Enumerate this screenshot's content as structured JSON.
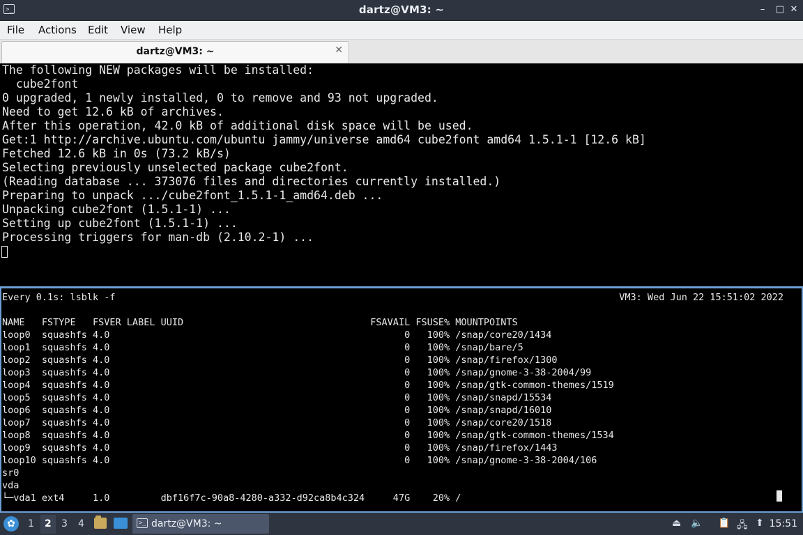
{
  "window": {
    "title": "dartz@VM3: ~",
    "app_icon": ">_",
    "minimize": "–",
    "maximize": "□",
    "close": "✕"
  },
  "menu": {
    "file": "File",
    "actions": "Actions",
    "edit": "Edit",
    "view": "View",
    "help": "Help"
  },
  "tab": {
    "label": "dartz@VM3: ~",
    "close": "✕"
  },
  "term_top": {
    "lines": [
      "The following NEW packages will be installed:",
      "  cube2font",
      "0 upgraded, 1 newly installed, 0 to remove and 93 not upgraded.",
      "Need to get 12.6 kB of archives.",
      "After this operation, 42.0 kB of additional disk space will be used.",
      "Get:1 http://archive.ubuntu.com/ubuntu jammy/universe amd64 cube2font amd64 1.5.1-1 [12.6 kB]",
      "Fetched 12.6 kB in 0s (73.2 kB/s)",
      "Selecting previously unselected package cube2font.",
      "(Reading database ... 373076 files and directories currently installed.)",
      "Preparing to unpack .../cube2font_1.5.1-1_amd64.deb ...",
      "Unpacking cube2font (1.5.1-1) ...",
      "Setting up cube2font (1.5.1-1) ...",
      "Processing triggers for man-db (2.10.2-1) ..."
    ]
  },
  "term_bottom": {
    "header_left": "Every 0.1s: lsblk -f",
    "header_right": "VM3: Wed Jun 22 15:51:02 2022",
    "lines": [
      "NAME   FSTYPE   FSVER LABEL UUID                                 FSAVAIL FSUSE% MOUNTPOINTS",
      "loop0  squashfs 4.0                                                    0   100% /snap/core20/1434",
      "loop1  squashfs 4.0                                                    0   100% /snap/bare/5",
      "loop2  squashfs 4.0                                                    0   100% /snap/firefox/1300",
      "loop3  squashfs 4.0                                                    0   100% /snap/gnome-3-38-2004/99",
      "loop4  squashfs 4.0                                                    0   100% /snap/gtk-common-themes/1519",
      "loop5  squashfs 4.0                                                    0   100% /snap/snapd/15534",
      "loop6  squashfs 4.0                                                    0   100% /snap/snapd/16010",
      "loop7  squashfs 4.0                                                    0   100% /snap/core20/1518",
      "loop8  squashfs 4.0                                                    0   100% /snap/gtk-common-themes/1534",
      "loop9  squashfs 4.0                                                    0   100% /snap/firefox/1443",
      "loop10 squashfs 4.0                                                    0   100% /snap/gnome-3-38-2004/106",
      "sr0",
      "vda",
      "└─vda1 ext4     1.0         dbf16f7c-90a8-4280-a332-d92ca8b4c324     47G    20% /"
    ]
  },
  "taskbar": {
    "start_icon": "✿",
    "workspaces": [
      "1",
      "2",
      "3",
      "4"
    ],
    "active_workspace": "2",
    "task_label": "dartz@VM3: ~",
    "task_icon": ">_",
    "clock": "15:51",
    "tray_icons": [
      "eject-icon",
      "volume-icon",
      "clipboard-icon",
      "network-icon",
      "update-icon"
    ]
  },
  "colors": {
    "accent": "#6d9fd5",
    "panel": "#2e3440",
    "terminal_bg": "#000000",
    "terminal_fg": "#e8e8e8"
  }
}
